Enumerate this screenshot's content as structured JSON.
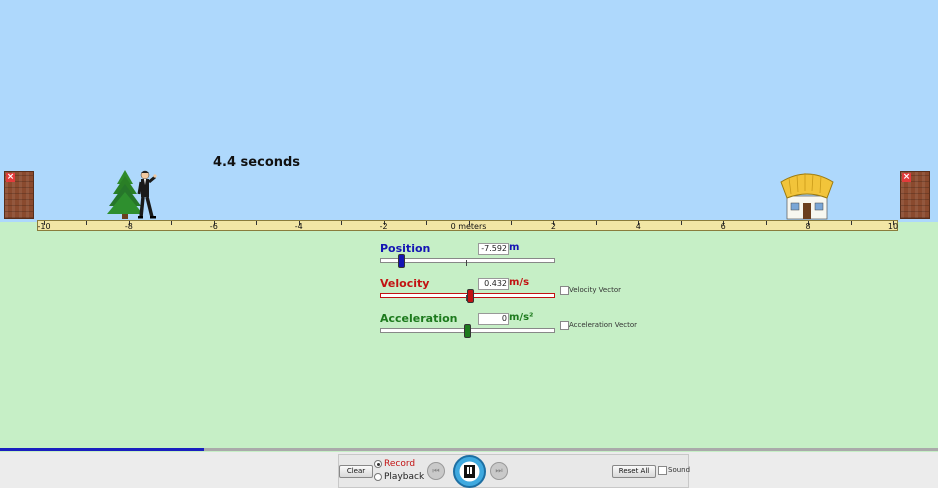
{
  "clock": {
    "text": "4.4 seconds"
  },
  "ruler": {
    "unit_label": "0 meters",
    "tick_labels": [
      "-10",
      "-8",
      "-6",
      "-4",
      "-2",
      "0 meters",
      "2",
      "4",
      "6",
      "8",
      "10"
    ]
  },
  "controls": {
    "position": {
      "title": "Position",
      "value": "-7.592",
      "unit": "m",
      "color": "#1414b4",
      "slider_fraction": 0.12
    },
    "velocity": {
      "title": "Velocity",
      "value": "0.432",
      "unit": "m/s",
      "color": "#c21212",
      "slider_fraction": 0.52,
      "vector_label": "Velocity Vector",
      "vector_checked": false
    },
    "acceleration": {
      "title": "Acceleration",
      "value": "0",
      "unit": "m/s²",
      "color": "#1d7a1d",
      "slider_fraction": 0.5,
      "vector_label": "Acceleration Vector",
      "vector_checked": false
    }
  },
  "playback": {
    "clear_label": "Clear",
    "record_label": "Record",
    "playback_label": "Playback",
    "mode": "record",
    "reset_label": "Reset All",
    "sound_label": "Sound",
    "sound_checked": false,
    "timeline_fraction": 0.217
  },
  "icons": {
    "wall_close": "close-icon",
    "rewind": "rewind-icon",
    "pause": "pause-icon",
    "step": "step-forward-icon"
  },
  "colors": {
    "sky": "#aed8fc",
    "ground": "#c6efc6",
    "ruler": "#f2e6a5",
    "timeline": "#1a1fbf"
  }
}
